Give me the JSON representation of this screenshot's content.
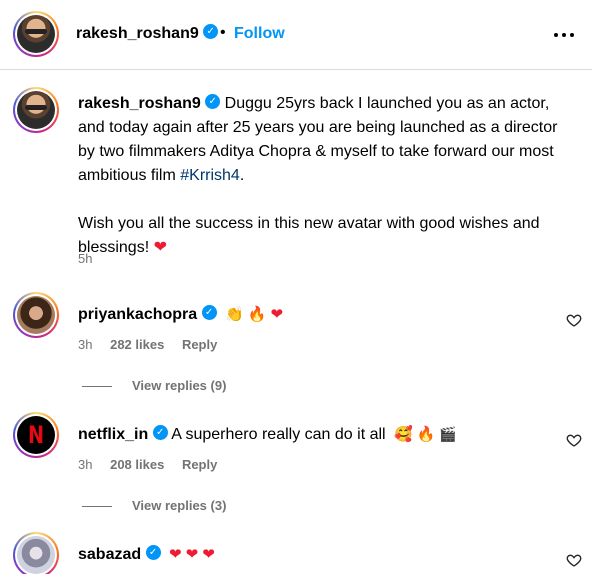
{
  "post": {
    "author": "rakesh_roshan9",
    "follow_label": "Follow",
    "header_separator": "•"
  },
  "caption": {
    "author": "rakesh_roshan9",
    "text_line1": "Duggu 25yrs back I launched you as an actor, and today again after 25 years you are being launched as a director by two filmmakers Aditya Chopra & myself to take forward our most ambitious film ",
    "hashtag": "#Krrish4",
    "text_line1_end": ".",
    "text_line2": "Wish you all the success in this new avatar with good wishes and blessings! ",
    "time": "5h"
  },
  "comments": [
    {
      "author": "priyankachopra",
      "text": "",
      "emojis": [
        "clapping-hands-emoji",
        "fire-emoji",
        "red-heart-emoji"
      ],
      "time": "3h",
      "likes": "282 likes",
      "reply_label": "Reply",
      "view_replies": "View replies (9)"
    },
    {
      "author": "netflix_in",
      "text": "A superhero really can do it all",
      "emojis": [
        "smiling-face-with-hearts-emoji",
        "fire-emoji",
        "clapper-board-emoji"
      ],
      "time": "3h",
      "likes": "208 likes",
      "reply_label": "Reply",
      "view_replies": "View replies (3)"
    },
    {
      "author": "sabazad",
      "text": "",
      "emojis": [
        "red-heart-emoji",
        "red-heart-emoji",
        "red-heart-emoji"
      ],
      "time": "",
      "likes": "",
      "reply_label": ""
    }
  ],
  "colors": {
    "accent": "#0095f6",
    "hashtag": "#00376b",
    "muted": "#737373",
    "heart": "#ed1c33"
  }
}
